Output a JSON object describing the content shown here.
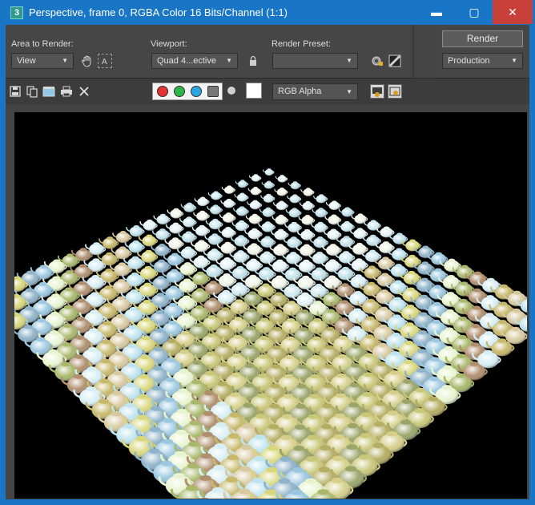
{
  "window": {
    "title": "Perspective, frame 0, RGBA Color 16 Bits/Channel (1:1)",
    "app_icon_text": "3",
    "min_glyph": "▬",
    "max_glyph": "▢",
    "close_glyph": "✕"
  },
  "controls": {
    "area_label": "Area to Render:",
    "area_value": "View",
    "viewport_label": "Viewport:",
    "viewport_value": "Quad 4...ective",
    "preset_label": "Render Preset:",
    "preset_value": "",
    "render_label": "Render",
    "production_value": "Production"
  },
  "toolbar": {
    "channel_value": "RGB Alpha"
  },
  "colors": {
    "title_bar": "#1976c6",
    "close_button": "#c9403a",
    "red_channel": "#e23232",
    "green_channel": "#2fb54a",
    "blue_channel": "#2aa7e0",
    "panel": "#444444",
    "render_bg": "#000000"
  }
}
